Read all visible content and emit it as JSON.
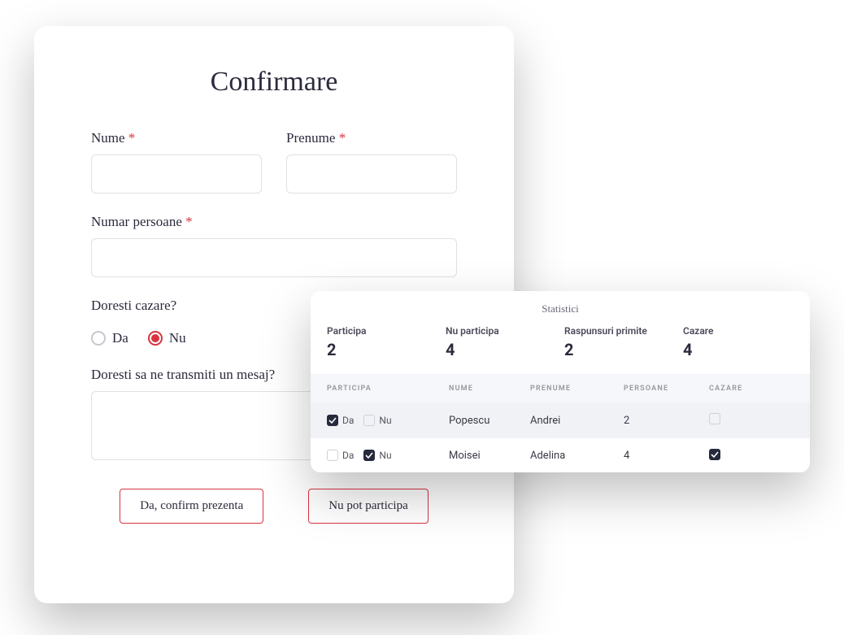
{
  "form": {
    "title": "Confirmare",
    "nume_label": "Nume",
    "prenume_label": "Prenume",
    "numar_label": "Numar persoane",
    "cazare_label": "Doresti cazare?",
    "radio_da": "Da",
    "radio_nu": "Nu",
    "radio_selected": "Nu",
    "mesaj_label": "Doresti sa ne transmiti un mesaj?",
    "confirm_btn": "Da, confirm prezenta",
    "decline_btn": "Nu pot participa",
    "asterisk": "*"
  },
  "stats": {
    "title": "Statistici",
    "items": [
      {
        "label": "Participa",
        "value": "2"
      },
      {
        "label": "Nu participa",
        "value": "4"
      },
      {
        "label": "Raspunsuri primite",
        "value": "2"
      },
      {
        "label": "Cazare",
        "value": "4"
      }
    ]
  },
  "table": {
    "headers": {
      "participa": "PARTICIPA",
      "nume": "NUME",
      "prenume": "PRENUME",
      "persoane": "PERSOANE",
      "cazare": "CAZARE"
    },
    "rows": [
      {
        "da": true,
        "nu": false,
        "da_label": "Da",
        "nu_label": "Nu",
        "nume": "Popescu",
        "prenume": "Andrei",
        "persoane": "2",
        "cazare": false
      },
      {
        "da": false,
        "nu": true,
        "da_label": "Da",
        "nu_label": "Nu",
        "nume": "Moisei",
        "prenume": "Adelina",
        "persoane": "4",
        "cazare": true
      }
    ]
  }
}
